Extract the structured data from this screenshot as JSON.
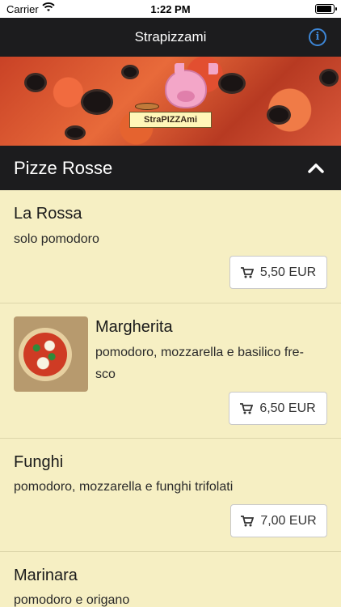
{
  "status_bar": {
    "carrier": "Carrier",
    "time": "1:22 PM"
  },
  "nav": {
    "title": "Strapizzami",
    "info_icon": "info-icon"
  },
  "banner": {
    "logo_text": "StraPIZZAmi"
  },
  "section": {
    "title": "Pizze Rosse",
    "chevron_icon": "chevron-up-icon"
  },
  "products": [
    {
      "name": "La Rossa",
      "desc_lines": [
        "solo pomodoro"
      ],
      "price": "5,50 EUR",
      "has_image": false
    },
    {
      "name": "Margherita",
      "desc_lines": [
        "pomodoro, mozzarella e basilico fre-",
        "sco"
      ],
      "price": "6,50 EUR",
      "has_image": true
    },
    {
      "name": "Funghi",
      "desc_lines": [
        "pomodoro, mozzarella e funghi trifolati"
      ],
      "price": "7,00 EUR",
      "has_image": false
    },
    {
      "name": "Marinara",
      "desc_lines": [
        "pomodoro e origano"
      ],
      "price": "",
      "has_image": false
    }
  ],
  "icons": {
    "cart": "cart-icon"
  }
}
